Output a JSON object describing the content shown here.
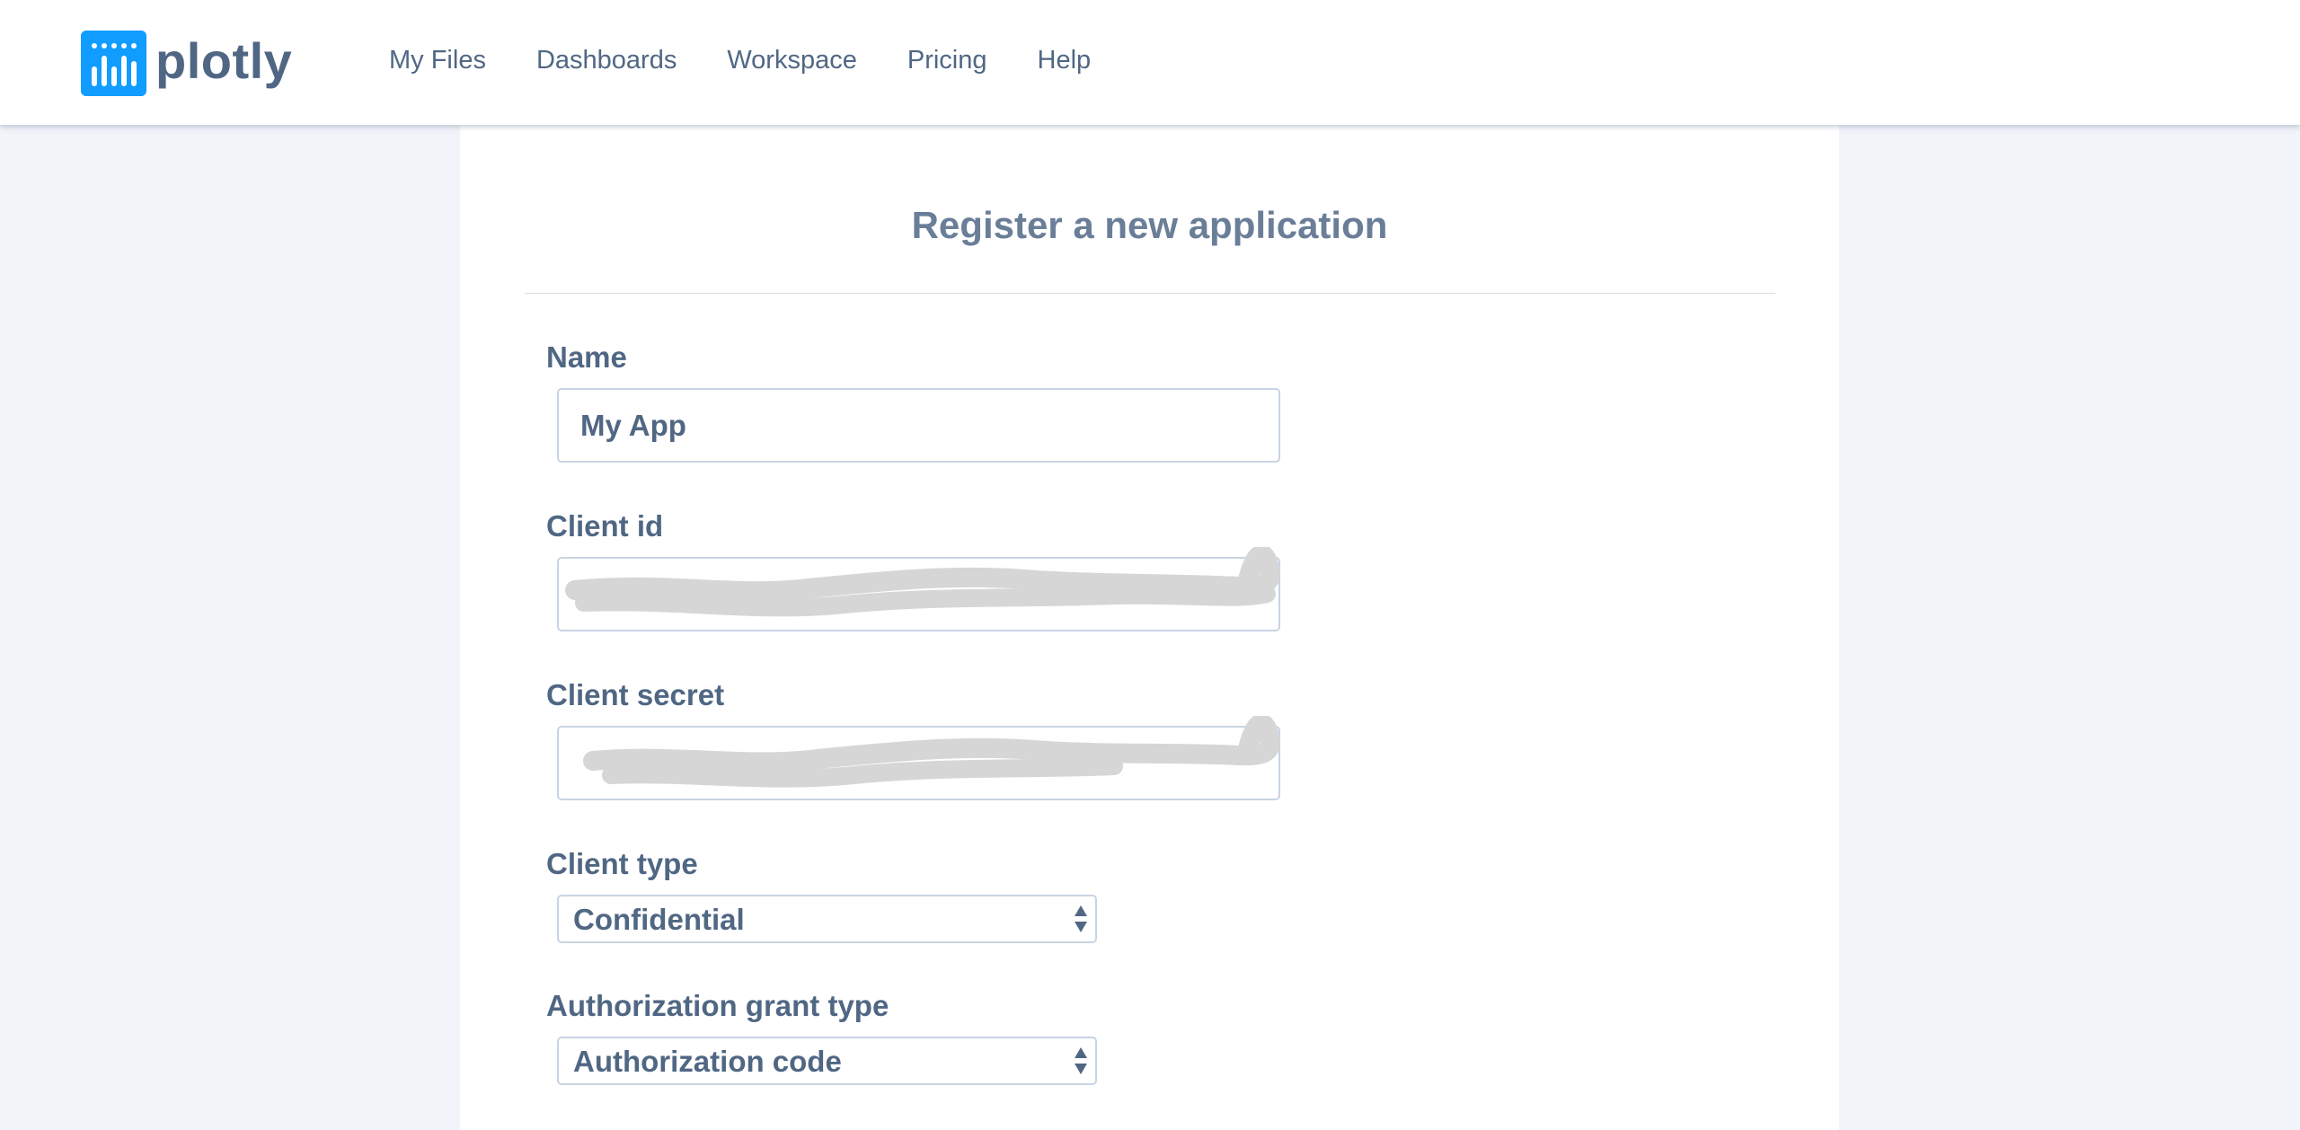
{
  "brand": {
    "name": "plotly",
    "logo_icon": "plotly-bars-icon",
    "logo_color": "#119dff"
  },
  "nav": {
    "items": [
      {
        "label": "My Files"
      },
      {
        "label": "Dashboards"
      },
      {
        "label": "Workspace"
      },
      {
        "label": "Pricing"
      },
      {
        "label": "Help"
      }
    ]
  },
  "form": {
    "title": "Register a new application",
    "name": {
      "label": "Name",
      "value": "My App"
    },
    "client_id": {
      "label": "Client id",
      "value": "",
      "redacted": true
    },
    "client_secret": {
      "label": "Client secret",
      "value": "",
      "redacted": true
    },
    "client_type": {
      "label": "Client type",
      "selected": "Confidential"
    },
    "grant_type": {
      "label": "Authorization grant type",
      "selected": "Authorization code"
    }
  },
  "colors": {
    "text": "#506784",
    "accent": "#119dff",
    "page_bg": "#f1f4f9",
    "input_border": "#c8d4e3",
    "redaction": "#d6d6d6"
  }
}
